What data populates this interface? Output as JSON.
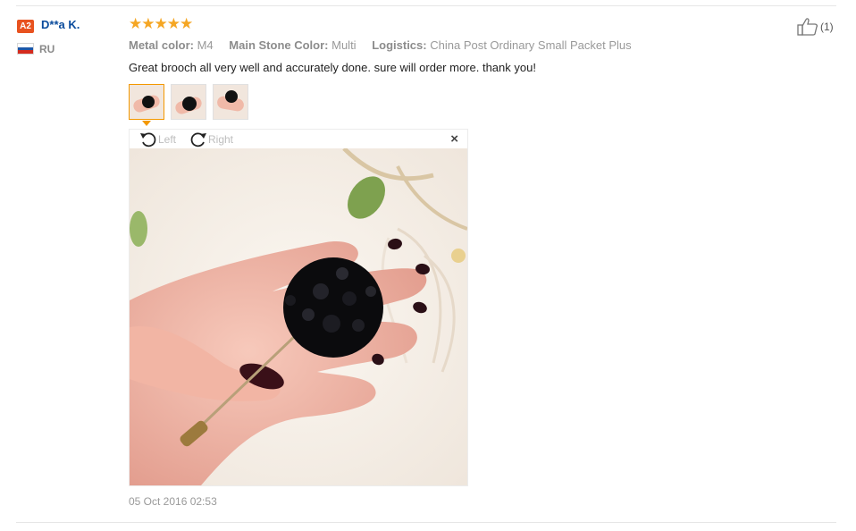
{
  "reviewer": {
    "level": "A2",
    "name": "D**a K.",
    "country": "RU"
  },
  "rating": {
    "stars": 5,
    "max": 5,
    "glyphs": "★★★★★"
  },
  "attributes": [
    {
      "label": "Metal color:",
      "value": "M4"
    },
    {
      "label": "Main Stone Color:",
      "value": "Multi"
    },
    {
      "label": "Logistics:",
      "value": "China Post Ordinary Small Packet Plus"
    }
  ],
  "review_text": "Great brooch all very well and accurately done. sure will order more. thank you!",
  "photos": {
    "count": 3,
    "active_index": 0
  },
  "viewer": {
    "rotate_left": "Left",
    "rotate_right": "Right",
    "close": "×"
  },
  "date": "05 Oct 2016 02:53",
  "helpful": {
    "count_text": "(1)"
  },
  "colors": {
    "level_badge": "#e8521f",
    "name_link": "#0a4b9c",
    "star": "#f5a623",
    "active_thumb_border": "#f39800"
  },
  "icons": {
    "flag": "russia-flag-icon",
    "thumbs_up": "thumbs-up-icon",
    "rotate_left": "rotate-left-icon",
    "rotate_right": "rotate-right-icon",
    "close": "close-icon"
  }
}
